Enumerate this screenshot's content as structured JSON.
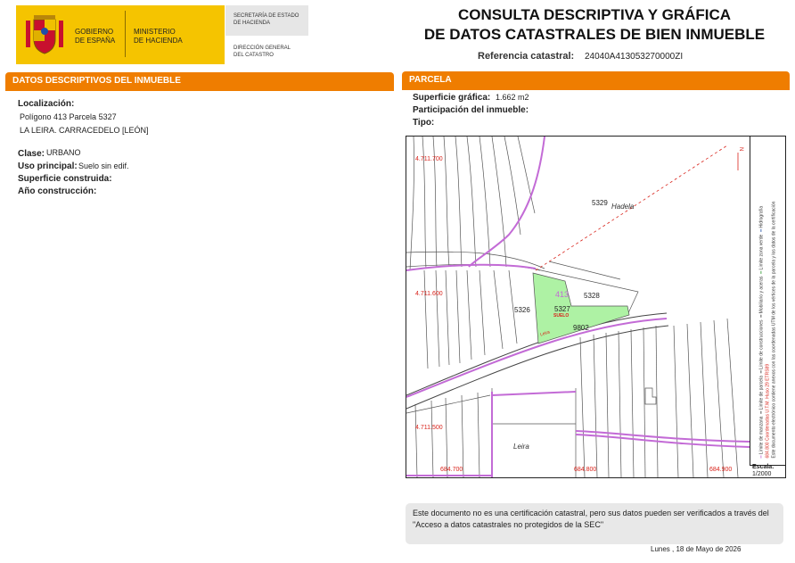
{
  "header": {
    "gobierno": [
      "GOBIERNO",
      "DE ESPAÑA"
    ],
    "ministerio": [
      "MINISTERIO",
      "DE HACIENDA"
    ],
    "secretaria": [
      "SECRETARÍA DE ESTADO",
      "DE HACIENDA"
    ],
    "direccion": [
      "DIRECCIÓN GENERAL",
      "DEL CATASTRO"
    ],
    "title_line1": "CONSULTA DESCRIPTIVA Y GRÁFICA",
    "title_line2": "DE DATOS CATASTRALES DE BIEN INMUEBLE",
    "ref_label": "Referencia catastral:",
    "ref_value": "24040A413053270000ZI"
  },
  "left": {
    "section_title": "DATOS DESCRIPTIVOS DEL INMUEBLE",
    "localizacion_label": "Localización:",
    "localizacion_line1": "Polígono 413 Parcela 5327",
    "localizacion_line2": "LA LEIRA. CARRACEDELO [LEÓN]",
    "clase_label": "Clase:",
    "clase_value": "URBANO",
    "uso_label": "Uso principal:",
    "uso_value": "Suelo sin edif.",
    "superficie_label": "Superficie construida:",
    "anio_label": "Año construcción:"
  },
  "right": {
    "section_title": "PARCELA",
    "superficie_label": "Superficie gráfica:",
    "superficie_value": "1.662 m2",
    "participacion_label": "Participación del inmueble:",
    "tipo_label": "Tipo:"
  },
  "map": {
    "y_labels": [
      "4.711.700",
      "4.711.600",
      "4.711.500"
    ],
    "x_labels": [
      "684.700",
      "684.800",
      "684.900"
    ],
    "parcel_labels": [
      "5329",
      "5328",
      "5327",
      "5326",
      "9802",
      "413"
    ],
    "suelo_label": "SUELO",
    "place_labels": [
      "Hadela",
      "Leira",
      "Leira"
    ],
    "legend": [
      "Límite de manzana",
      "Límite de parcela",
      "Límite de construcciones",
      "Mobiliario y aceras",
      "Límite zona verde",
      "Hidrografía"
    ],
    "side_note": "Este documento electrónico contiene anexos con las coordenadas UTM de los vértices de la parcela y los datos de la certificación",
    "coord_note": "684.800 Coordenadas U.T.M. Huso 29 ETRS89",
    "scale_label": "Escala:",
    "scale_value": "1/2000",
    "colors": {
      "parcel_fill": "#aef2a4",
      "pink": "#c36bd6",
      "coord_red": "#d9241c"
    }
  },
  "footer": {
    "note": "Este documento no es una certificación catastral, pero sus datos pueden ser verificados a través del \"Acceso a datos catastrales no protegidos de la SEC\"",
    "date": "Lunes , 18 de Mayo de 2026"
  }
}
